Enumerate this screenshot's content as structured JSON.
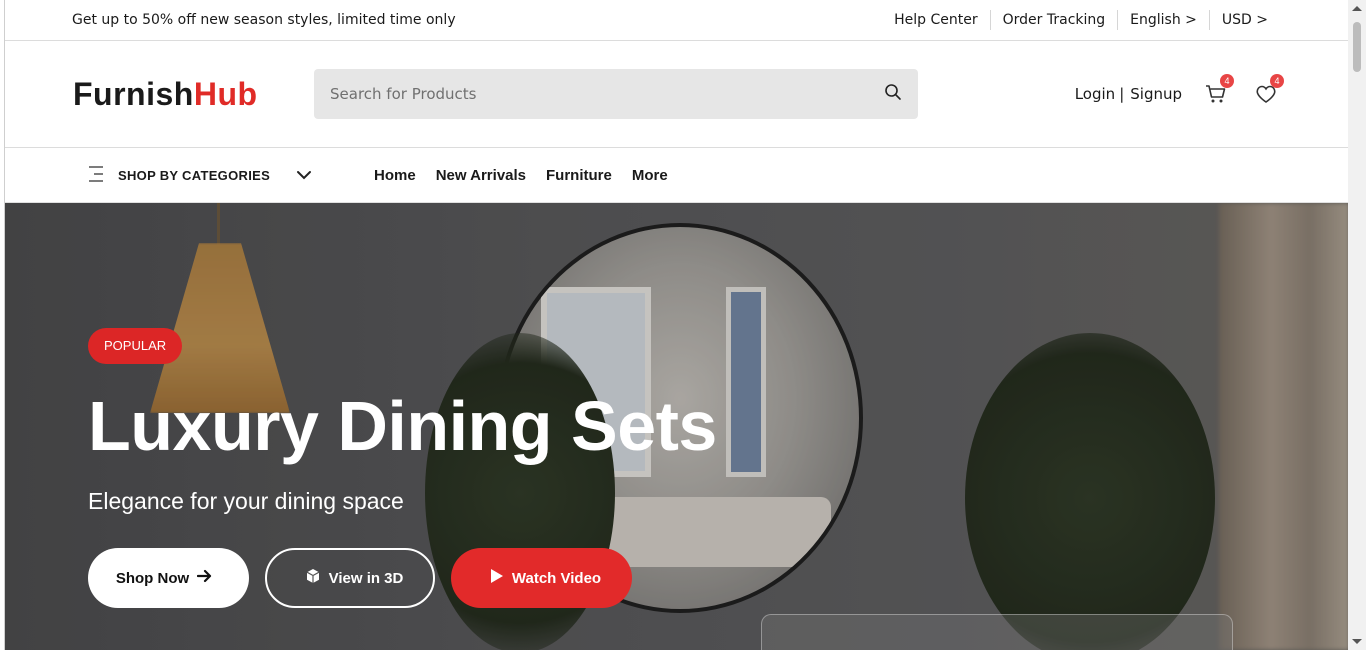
{
  "topbar": {
    "promo": "Get up to 50% off new season styles, limited time only",
    "links": [
      "Help Center",
      "Order Tracking",
      "English >",
      "USD >"
    ]
  },
  "header": {
    "logo_part1": "Furnish",
    "logo_part2": "Hub",
    "search_placeholder": "Search for Products",
    "login": "Login",
    "separator": "|",
    "signup": "Signup",
    "cart_count": "4",
    "wishlist_count": "4"
  },
  "nav": {
    "categories_label": "SHOP BY CATEGORIES",
    "items": [
      "Home",
      "New Arrivals",
      "Furniture",
      "More"
    ]
  },
  "hero": {
    "badge": "POPULAR",
    "title": "Luxury Dining Sets",
    "subtitle": "Elegance for your dining space",
    "btn_shop": "Shop Now",
    "btn_3d": "View in 3D",
    "btn_video": "Watch Video"
  },
  "colors": {
    "brand_red": "#e02b27",
    "badge_red": "#e84545"
  }
}
